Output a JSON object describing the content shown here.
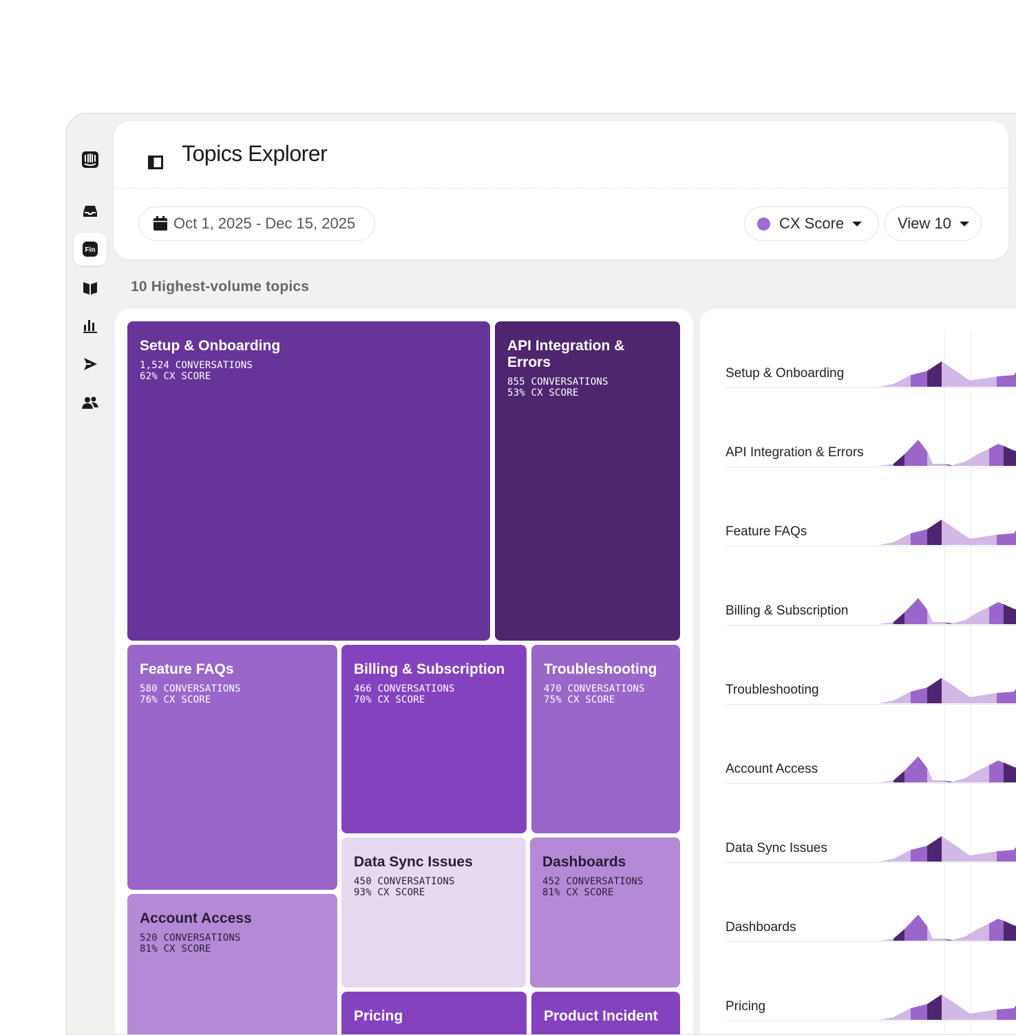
{
  "header": {
    "title": "Topics Explorer",
    "date_range": "Oct 1, 2025 - Dec 15, 2025",
    "metric_select": "CX Score",
    "view_select": "View 10"
  },
  "sidebar": {
    "items": [
      {
        "icon": "intercom-logo-icon"
      },
      {
        "icon": "inbox-icon"
      },
      {
        "icon": "fin-icon",
        "label": "Fin"
      },
      {
        "icon": "knowledge-book-icon"
      },
      {
        "icon": "reports-chart-icon"
      },
      {
        "icon": "outbound-send-icon"
      },
      {
        "icon": "contacts-people-icon"
      }
    ]
  },
  "section_label": "10 Highest-volume topics",
  "colors": {
    "accent": "#9a6bd0",
    "dark_purple": "#4e266f",
    "mid_purple": "#673499",
    "violet": "#8442bf",
    "medium": "#9a66c9",
    "soft": "#b48ad6",
    "pale": "#e6d9f0"
  },
  "treemap": [
    {
      "name": "Setup & Onboarding",
      "conversations": "1,524 CONVERSATIONS",
      "cx_score": "62% CX SCORE"
    },
    {
      "name": "API Integration & Errors",
      "conversations": "855 CONVERSATIONS",
      "cx_score": "53% CX SCORE"
    },
    {
      "name": "Feature FAQs",
      "conversations": "580 CONVERSATIONS",
      "cx_score": "76% CX SCORE"
    },
    {
      "name": "Billing & Subscription",
      "conversations": "466 CONVERSATIONS",
      "cx_score": "70% CX SCORE"
    },
    {
      "name": "Troubleshooting",
      "conversations": "470 CONVERSATIONS",
      "cx_score": "75% CX SCORE"
    },
    {
      "name": "Data Sync Issues",
      "conversations": "450 CONVERSATIONS",
      "cx_score": "93% CX SCORE"
    },
    {
      "name": "Dashboards",
      "conversations": "452 CONVERSATIONS",
      "cx_score": "81% CX SCORE"
    },
    {
      "name": "Account Access",
      "conversations": "520 CONVERSATIONS",
      "cx_score": "81% CX SCORE"
    },
    {
      "name": "Pricing",
      "conversations": "",
      "cx_score": ""
    },
    {
      "name": "Product Incident",
      "conversations": "",
      "cx_score": ""
    }
  ],
  "trends": [
    {
      "label": "Setup & Onboarding",
      "pattern": "a"
    },
    {
      "label": "API Integration & Errors",
      "pattern": "b"
    },
    {
      "label": "Feature FAQs",
      "pattern": "a"
    },
    {
      "label": "Billing & Subscription",
      "pattern": "b"
    },
    {
      "label": "Troubleshooting",
      "pattern": "a"
    },
    {
      "label": "Account Access",
      "pattern": "b"
    },
    {
      "label": "Data Sync Issues",
      "pattern": "a"
    },
    {
      "label": "Dashboards",
      "pattern": "b"
    },
    {
      "label": "Pricing",
      "pattern": "a"
    }
  ]
}
